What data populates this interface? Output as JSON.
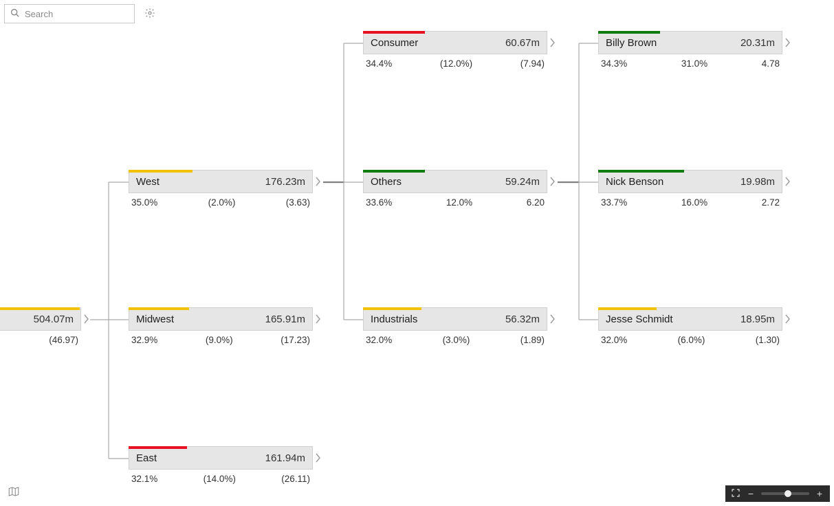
{
  "search": {
    "placeholder": "Search"
  },
  "colors": {
    "yellow": "#f2c200",
    "red": "#e81123",
    "green": "#107c10"
  },
  "root": {
    "value": "504.07m",
    "metric3": "(46.97)",
    "bar_color": "yellow",
    "bar_pct": 100
  },
  "level1": [
    {
      "title": "West",
      "value": "176.23m",
      "m1": "35.0%",
      "m2": "(2.0%)",
      "m3": "(3.63)",
      "bar_color": "yellow",
      "bar_pct": 35
    },
    {
      "title": "Midwest",
      "value": "165.91m",
      "m1": "32.9%",
      "m2": "(9.0%)",
      "m3": "(17.23)",
      "bar_color": "yellow",
      "bar_pct": 33
    },
    {
      "title": "East",
      "value": "161.94m",
      "m1": "32.1%",
      "m2": "(14.0%)",
      "m3": "(26.11)",
      "bar_color": "red",
      "bar_pct": 32
    }
  ],
  "level2": [
    {
      "title": "Consumer",
      "value": "60.67m",
      "m1": "34.4%",
      "m2": "(12.0%)",
      "m3": "(7.94)",
      "bar_color": "red",
      "bar_pct": 34
    },
    {
      "title": "Others",
      "value": "59.24m",
      "m1": "33.6%",
      "m2": "12.0%",
      "m3": "6.20",
      "bar_color": "green",
      "bar_pct": 34
    },
    {
      "title": "Industrials",
      "value": "56.32m",
      "m1": "32.0%",
      "m2": "(3.0%)",
      "m3": "(1.89)",
      "bar_color": "yellow",
      "bar_pct": 32
    }
  ],
  "level3": [
    {
      "title": "Billy Brown",
      "value": "20.31m",
      "m1": "34.3%",
      "m2": "31.0%",
      "m3": "4.78",
      "bar_color": "green",
      "bar_pct": 34
    },
    {
      "title": "Nick Benson",
      "value": "19.98m",
      "m1": "33.7%",
      "m2": "16.0%",
      "m3": "2.72",
      "bar_color": "green",
      "bar_pct": 47
    },
    {
      "title": "Jesse Schmidt",
      "value": "18.95m",
      "m1": "32.0%",
      "m2": "(6.0%)",
      "m3": "(1.30)",
      "bar_color": "yellow",
      "bar_pct": 32
    }
  ],
  "zoom": {
    "thumb_pct": 55
  }
}
